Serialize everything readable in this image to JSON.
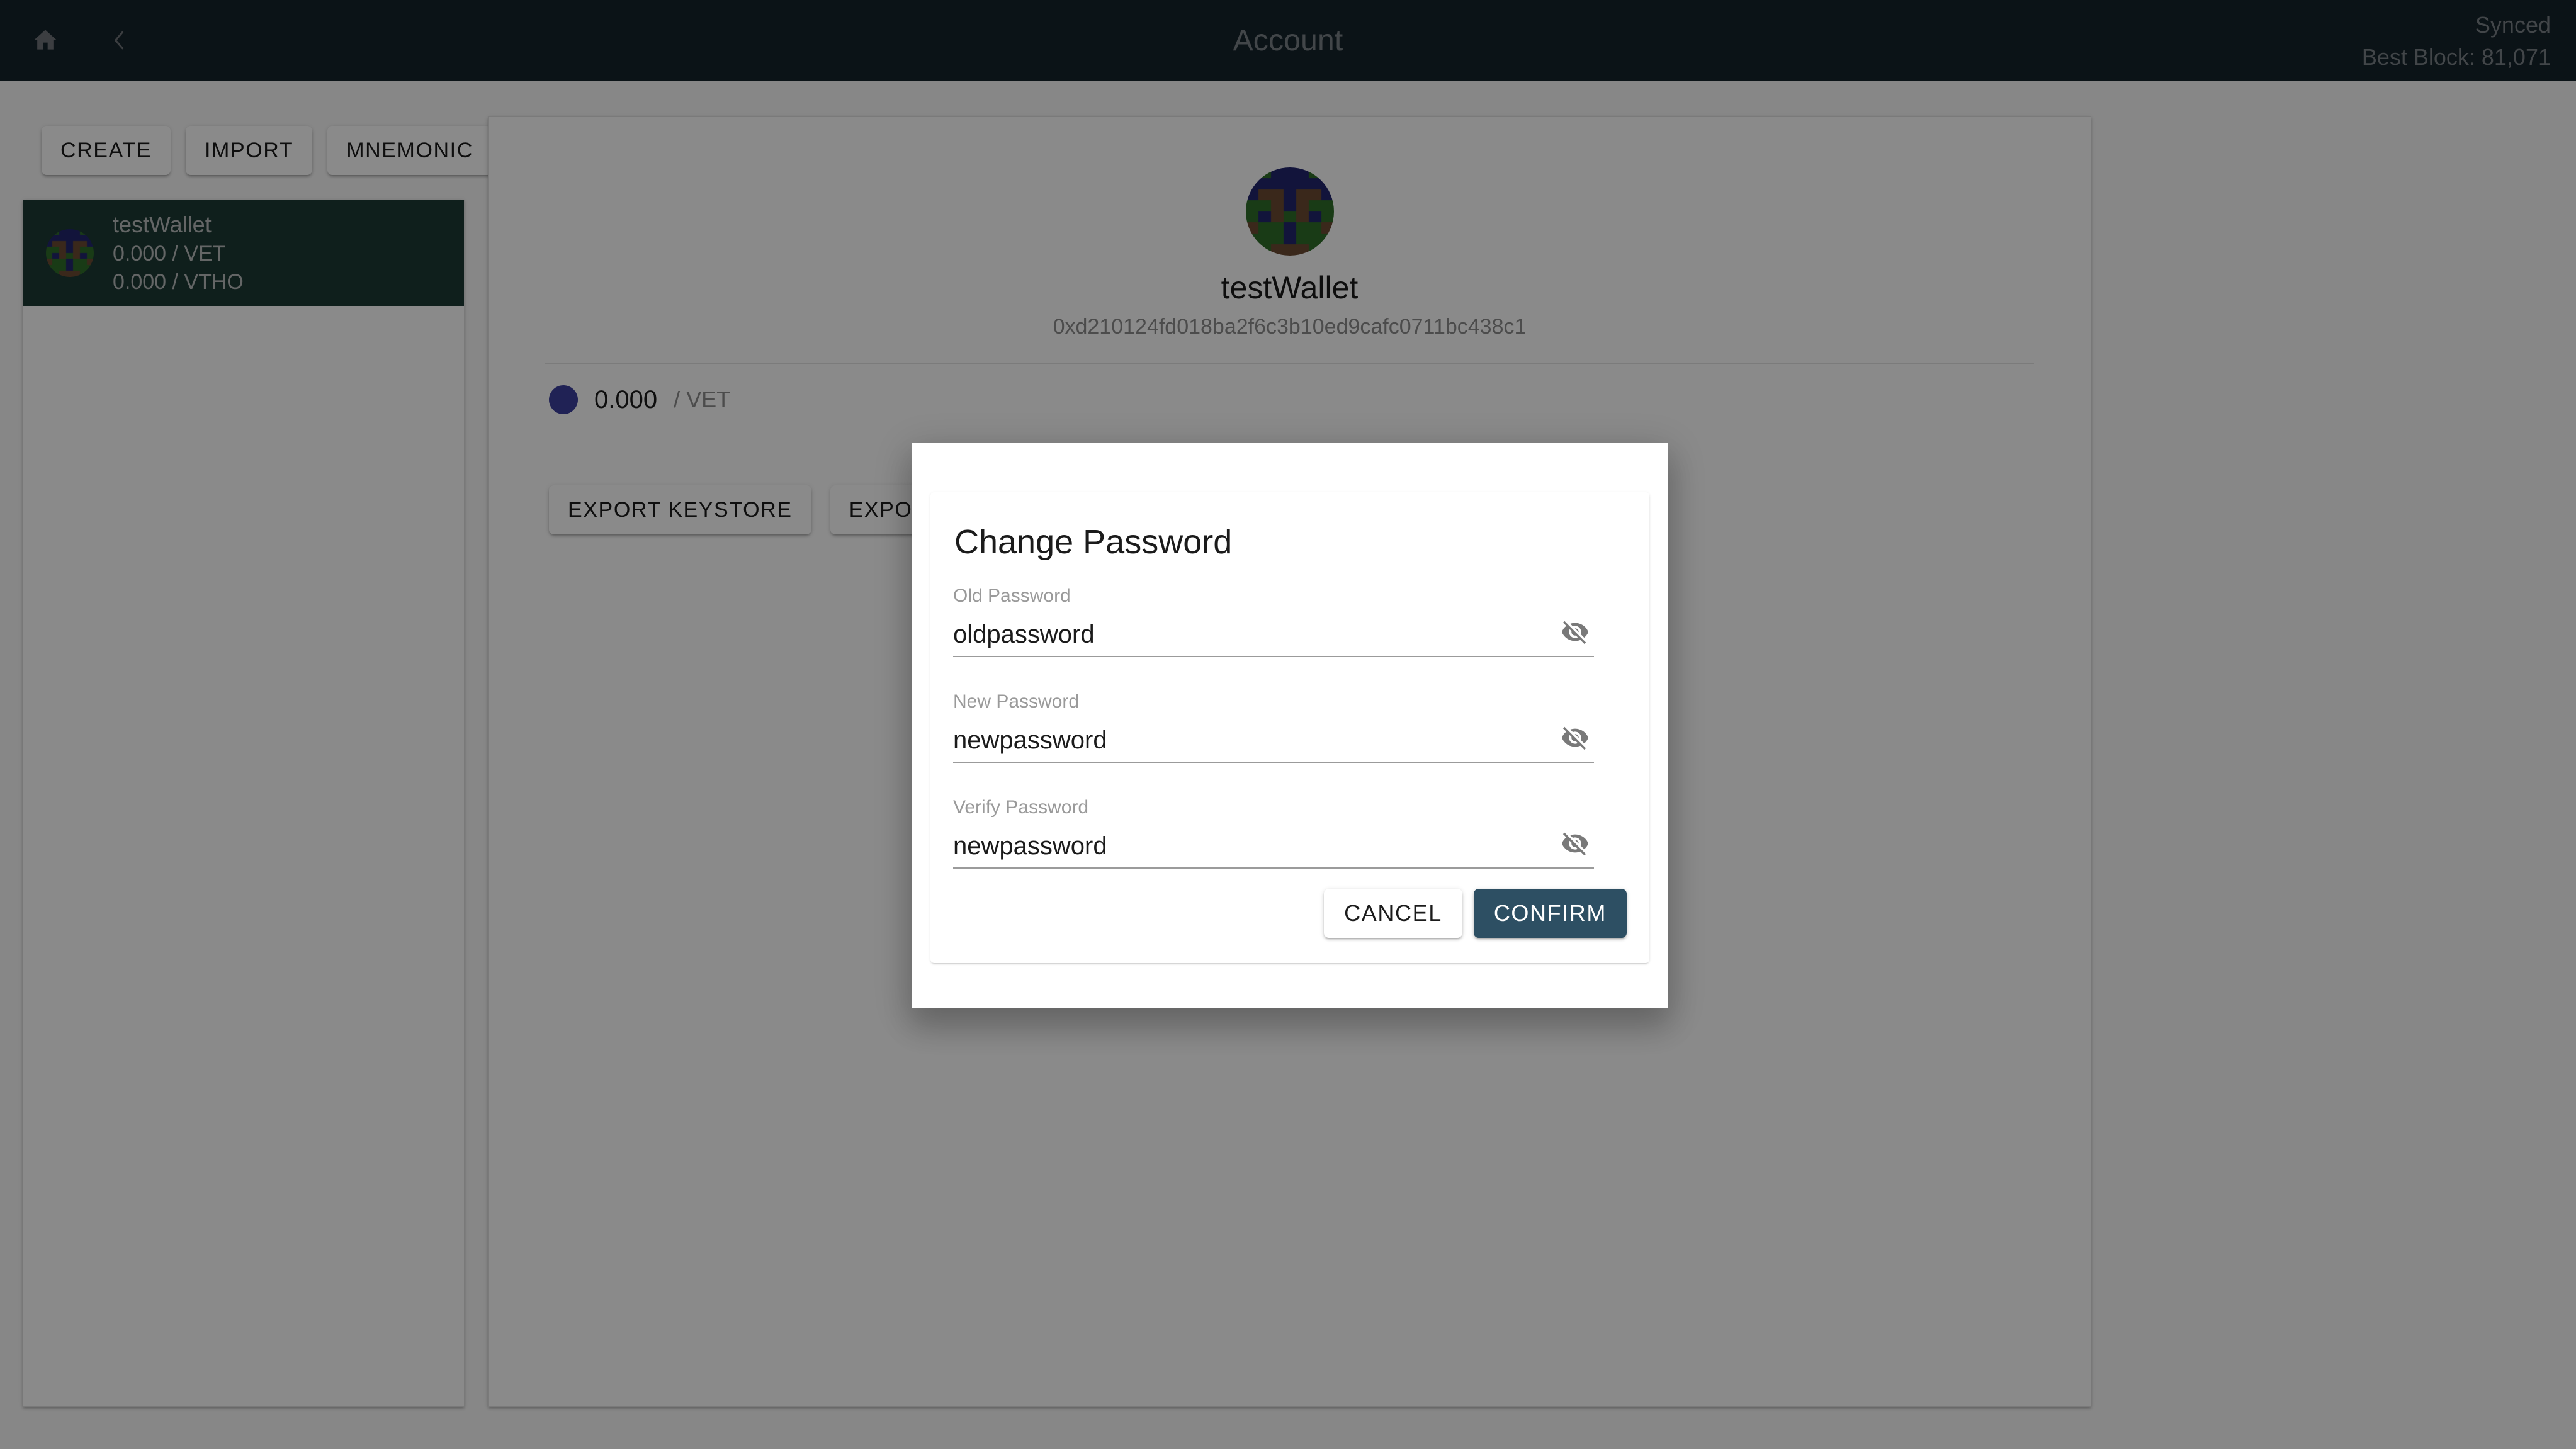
{
  "appbar": {
    "title": "Account",
    "home_icon": "home-icon",
    "back_icon": "chevron-left-icon",
    "sync_status": "Synced",
    "best_block": "Best Block: 81,071",
    "bg_color": "#16232b",
    "text_color": "#7b8287"
  },
  "sidebar": {
    "actions": [
      {
        "label": "CREATE",
        "name": "create-wallet-button"
      },
      {
        "label": "IMPORT",
        "name": "import-wallet-button"
      },
      {
        "label": "MNEMONIC",
        "name": "mnemonic-wallet-button"
      }
    ],
    "wallets": [
      {
        "name": "testWallet",
        "balance_vet": "0.000 / VET",
        "balance_vtho": "0.000 / VTHO",
        "selected": true,
        "selected_bg": "#1c3a35"
      }
    ]
  },
  "main": {
    "account_name": "testWallet",
    "account_address": "0xd210124fd018ba2f6c3b10ed9cafc0711bc438c1",
    "balances": [
      {
        "amount": "0.000",
        "symbol": "/ VET",
        "color": "#3b3f9e"
      }
    ],
    "actions": [
      {
        "label": "EXPORT KEYSTORE",
        "name": "export-keystore-button"
      },
      {
        "label": "EXPORT PRIVATE KEY",
        "name": "export-private-key-button"
      }
    ]
  },
  "dialog": {
    "title": "Change Password",
    "fields": [
      {
        "label": "Old Password",
        "value": "oldpassword",
        "placeholder": "",
        "name": "old-password-field",
        "toggle_icon": "eye-off-icon"
      },
      {
        "label": "New Password",
        "value": "newpassword",
        "placeholder": "",
        "name": "new-password-field",
        "toggle_icon": "eye-off-icon"
      },
      {
        "label": "Verify Password",
        "value": "newpassword",
        "placeholder": "",
        "name": "verify-password-field",
        "toggle_icon": "eye-off-icon"
      }
    ],
    "cancel_label": "CANCEL",
    "confirm_label": "CONFIRM",
    "confirm_color": "#2d4f63"
  },
  "identicon": {
    "bg": "#2f6d2a",
    "colors": {
      "green": "#2f6d2a",
      "navy": "#22256e",
      "brown": "#6b4b33"
    },
    "grid": [
      [
        "green",
        "green",
        "navy",
        "navy",
        "navy",
        "green",
        "green"
      ],
      [
        "navy",
        "navy",
        "navy",
        "navy",
        "navy",
        "navy",
        "navy"
      ],
      [
        "navy",
        "brown",
        "brown",
        "navy",
        "brown",
        "brown",
        "navy"
      ],
      [
        "green",
        "green",
        "brown",
        "navy",
        "brown",
        "green",
        "green"
      ],
      [
        "green",
        "navy",
        "brown",
        "green",
        "brown",
        "navy",
        "green"
      ],
      [
        "brown",
        "green",
        "green",
        "navy",
        "green",
        "green",
        "brown"
      ],
      [
        "green",
        "green",
        "green",
        "navy",
        "green",
        "green",
        "green"
      ],
      [
        "green",
        "green",
        "brown",
        "brown",
        "brown",
        "green",
        "green"
      ]
    ]
  }
}
